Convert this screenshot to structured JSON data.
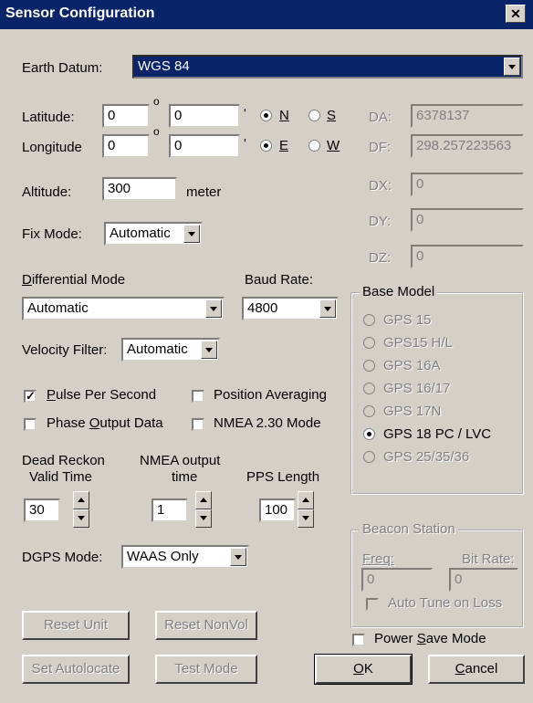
{
  "window": {
    "title": "Sensor Configuration",
    "close_symbol": "✕"
  },
  "earth_datum": {
    "label": "Earth Datum:",
    "value": "WGS 84"
  },
  "latitude": {
    "label": "Latitude:",
    "deg": "0",
    "min": "0",
    "deg_symbol": "o",
    "min_symbol": "'",
    "n_label": "N",
    "s_label": "S",
    "selected": "N"
  },
  "longitude": {
    "label": "Longitude",
    "deg": "0",
    "min": "0",
    "deg_symbol": "o",
    "min_symbol": "'",
    "e_label": "E",
    "w_label": "W",
    "selected": "E"
  },
  "altitude": {
    "label": "Altitude:",
    "value": "300",
    "unit": "meter"
  },
  "fix_mode": {
    "label": "Fix Mode:",
    "value": "Automatic"
  },
  "params": {
    "da_label": "DA:",
    "da_value": "6378137",
    "df_label": "DF:",
    "df_value": "298.257223563",
    "dx_label": "DX:",
    "dx_value": "0",
    "dy_label": "DY:",
    "dy_value": "0",
    "dz_label": "DZ:",
    "dz_value": "0"
  },
  "differential_mode": {
    "label": "Differential Mode",
    "value": "Automatic"
  },
  "baud_rate": {
    "label": "Baud Rate:",
    "value": "4800"
  },
  "velocity_filter": {
    "label": "Velocity Filter:",
    "value": "Automatic"
  },
  "checkboxes": {
    "pps": {
      "label": "Pulse Per Second",
      "checked": true
    },
    "position_averaging": {
      "label": "Position Averaging",
      "checked": false
    },
    "phase_output": {
      "label": "Phase Output Data",
      "checked": false
    },
    "nmea230": {
      "label": "NMEA 2.30 Mode",
      "checked": false
    }
  },
  "spinners": {
    "dead_reckon": {
      "label1": "Dead Reckon",
      "label2": "Valid Time",
      "value": "30"
    },
    "nmea_output": {
      "label1": "NMEA output",
      "label2": "time",
      "value": "1"
    },
    "pps_length": {
      "label": "PPS Length",
      "value": "100"
    }
  },
  "dgps_mode": {
    "label": "DGPS Mode:",
    "value": "WAAS Only"
  },
  "base_model": {
    "title": "Base Model",
    "options": [
      "GPS 15",
      "GPS15 H/L",
      "GPS 16A",
      "GPS 16/17",
      "GPS 17N",
      "GPS 18 PC / LVC",
      "GPS 25/35/36"
    ],
    "selected": "GPS 18 PC / LVC"
  },
  "beacon": {
    "title": "Beacon Station",
    "freq_label": "Freq:",
    "freq_value": "0",
    "bitrate_label": "Bit Rate:",
    "bitrate_value": "0",
    "autotune_label": "Auto Tune on Loss"
  },
  "power_save": {
    "label": "Power Save Mode",
    "checked": false
  },
  "buttons": {
    "reset_unit": "Reset Unit",
    "reset_nonvol": "Reset NonVol",
    "set_autolocate": "Set Autolocate",
    "test_mode": "Test Mode",
    "ok": "OK",
    "cancel": "Cancel"
  }
}
